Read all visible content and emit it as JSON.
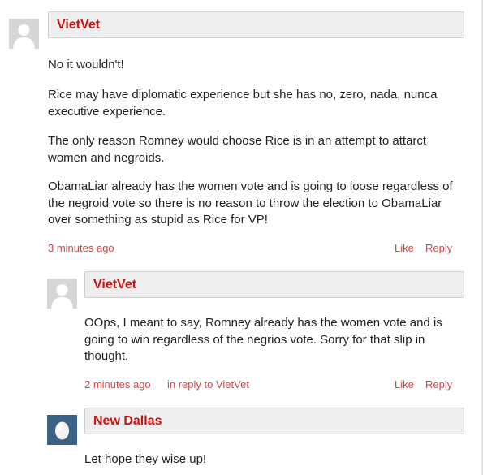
{
  "comments": [
    {
      "author": "VietVet",
      "paragraphs": [
        "No it wouldn't!",
        "Rice may have diplomatic experience but she has no, zero, nada, nunca executive experience.",
        "The only reason Romney would choose Rice is in an attempt to attarct women and negroids.",
        "ObamaLiar already has the women vote and is going to loose regardless of the negroid vote so there is no reason to throw the election to ObamaLiar over something as stupid as Rice for VP!"
      ],
      "time": "3 minutes ago",
      "like_label": "Like",
      "reply_label": "Reply"
    },
    {
      "author": "VietVet",
      "paragraphs": [
        "OOps, I meant to say, Romney already has the women vote and is going to win regardless of the negrios vote. Sorry for that slip in thought."
      ],
      "time": "2 minutes ago",
      "in_reply_to": "in reply to VietVet",
      "like_label": "Like",
      "reply_label": "Reply"
    },
    {
      "author": "New Dallas",
      "paragraphs": [
        "Let hope they wise up!"
      ]
    }
  ],
  "colors": {
    "author": "#cc1111",
    "meta": "#e0403f",
    "name_bar_bg": "#eeeeee",
    "text": "#222222"
  },
  "icons": {
    "default_avatar": "person-silhouette-icon",
    "egg_avatar": "egg-avatar-icon"
  }
}
